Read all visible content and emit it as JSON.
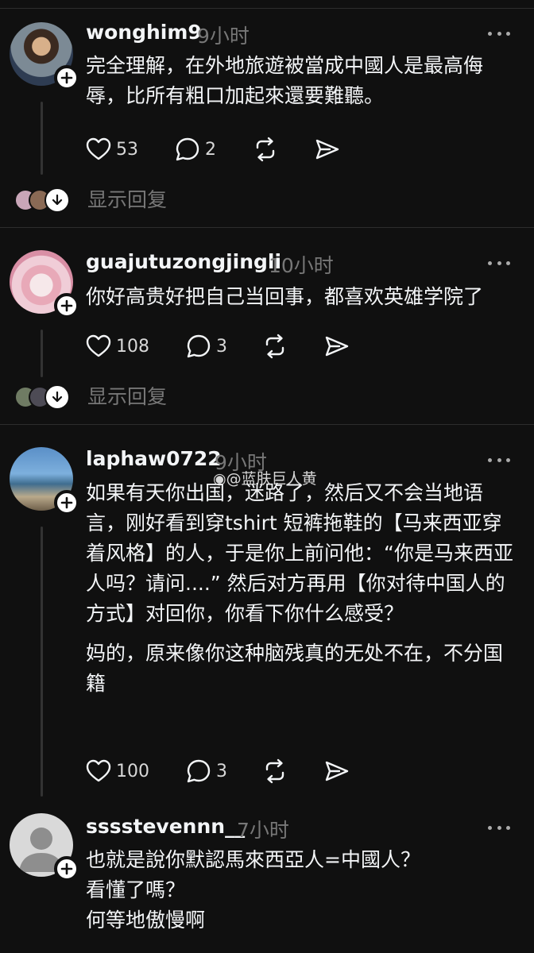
{
  "posts": [
    {
      "username": "wonghim9",
      "time": "9小时",
      "paragraphs": [
        "完全理解，在外地旅遊被當成中國人是最高侮辱，比所有粗口加起來還要難聽。"
      ],
      "likes": "53",
      "comments": "2",
      "show_replies": "显示回复"
    },
    {
      "username": "guajutuzongjingli",
      "time": "10小时",
      "paragraphs": [
        "你好高贵好把自己当回事，都喜欢英雄学院了"
      ],
      "likes": "108",
      "comments": "3",
      "show_replies": "显示回复"
    },
    {
      "username": "laphaw0722",
      "time": "9小时",
      "paragraphs": [
        "如果有天你出国，迷路了，然后又不会当地语言，刚好看到穿tshirt 短裤拖鞋的【马来西亚穿着风格】的人，于是你上前问他：“你是马来西亚人吗？请问....” 然后对方再用【你对待中国人的方式】对回你，你看下你什么感受？",
        "妈的，原来像你这种脑残真的无处不在，不分国籍"
      ],
      "likes": "100",
      "comments": "3"
    },
    {
      "username": "sssstevennn__",
      "time": "7小时",
      "lines": [
        "也就是說你默認馬來西亞人=中國人？",
        "看懂了嗎？",
        "何等地傲慢啊"
      ]
    }
  ],
  "watermark": "@蓝肤巨人黄"
}
